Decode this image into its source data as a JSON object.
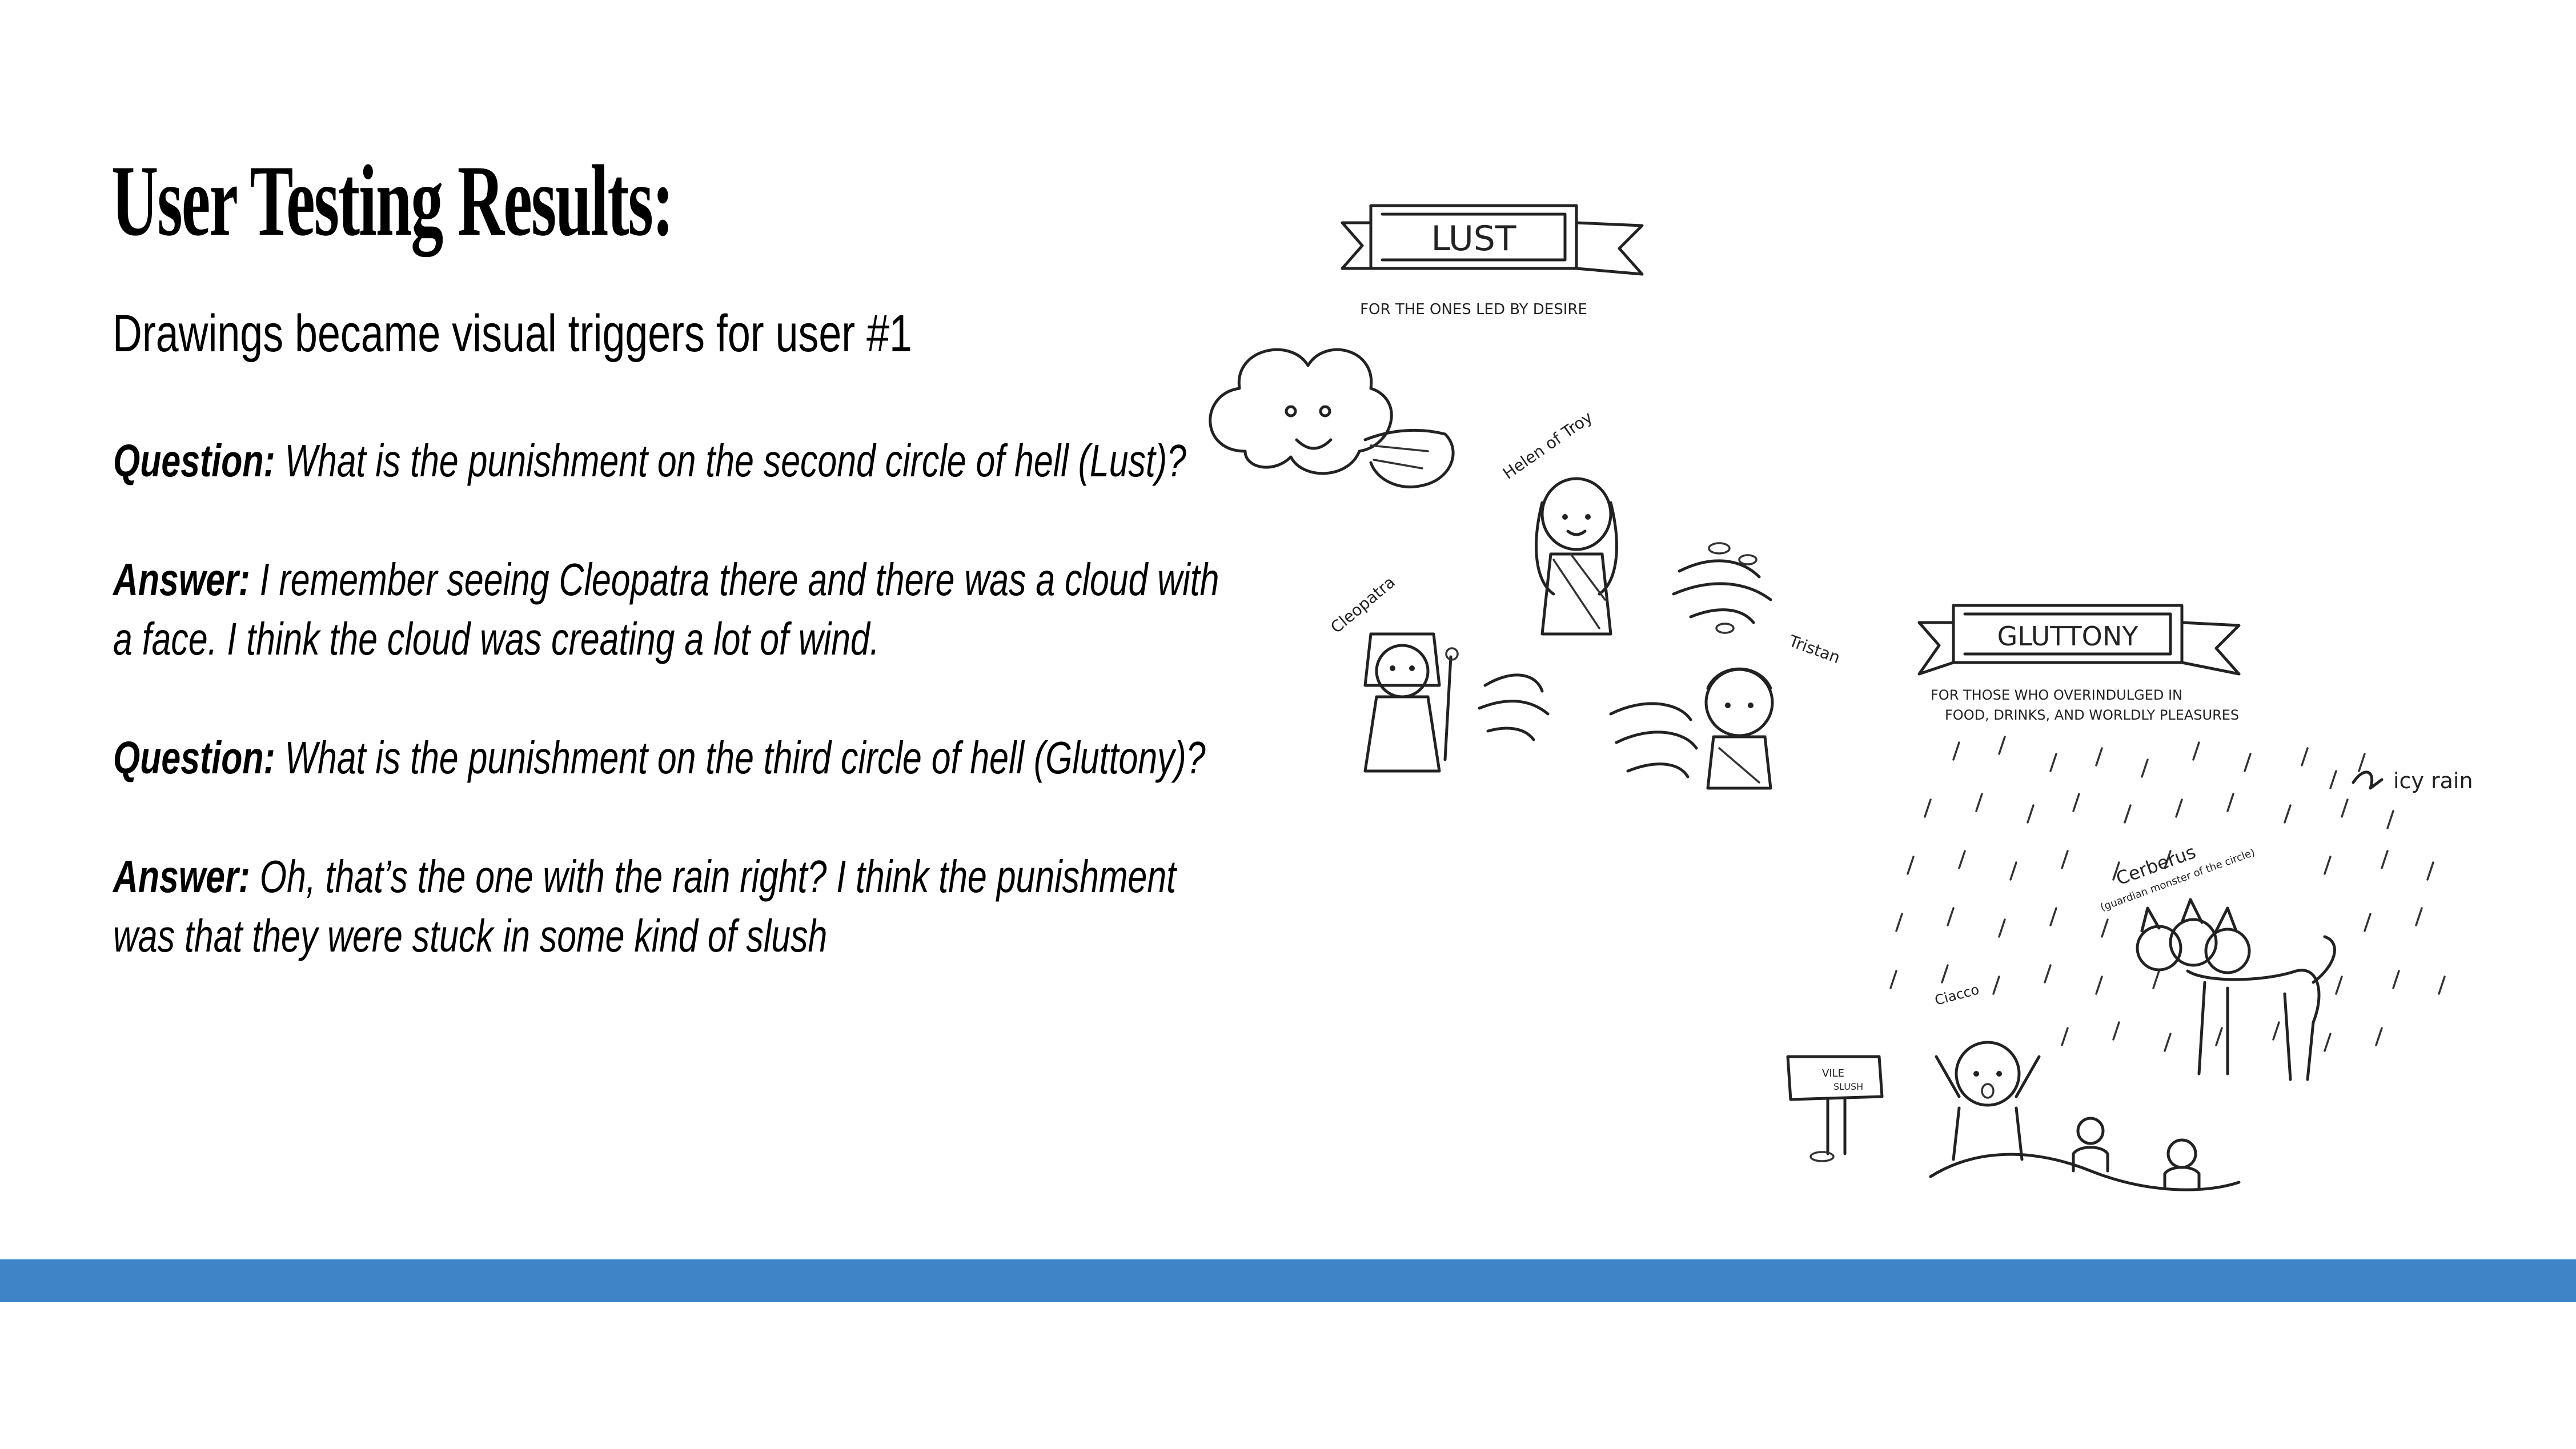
{
  "slide": {
    "title": "User Testing Results:",
    "subtitle": "Drawings became visual triggers for user #1"
  },
  "qa": [
    {
      "label": "Question:",
      "text": "What is the punishment on the second circle of hell (Lust)?"
    },
    {
      "label": "Answer:",
      "text": "I remember seeing Cleopatra there and there was a cloud with a face. I think the cloud was creating a lot of wind."
    },
    {
      "label": "Question:",
      "text": "What is the punishment on the third circle of hell (Gluttony)?"
    },
    {
      "label": "Answer:",
      "text": "Oh, that’s the one with the rain right? I think the punishment was that they were stuck in some kind of slush"
    }
  ],
  "illustration": {
    "lust_banner": "LUST",
    "lust_caption": "FOR THE ONES LED BY DESIRE",
    "helen_label": "Helen of Troy",
    "cleopatra_label": "Cleopatra",
    "tristan_label": "Tristan",
    "gluttony_banner": "GLUTTONY",
    "gluttony_caption_line1": "FOR THOSE WHO OVERINDULGED IN",
    "gluttony_caption_line2": "FOOD, DRINKS, AND WORLDLY PLEASURES",
    "icy_rain_label": "icy rain",
    "cerberus_label": "Cerberus",
    "cerberus_sub": "(guardian monster of the circle)",
    "ciacco_label": "Ciacco",
    "sign_line1": "VILE",
    "sign_line2": "SLUSH"
  },
  "colors": {
    "accent_bar": "#3e84c6",
    "background": "#ffffff",
    "text": "#000000"
  }
}
